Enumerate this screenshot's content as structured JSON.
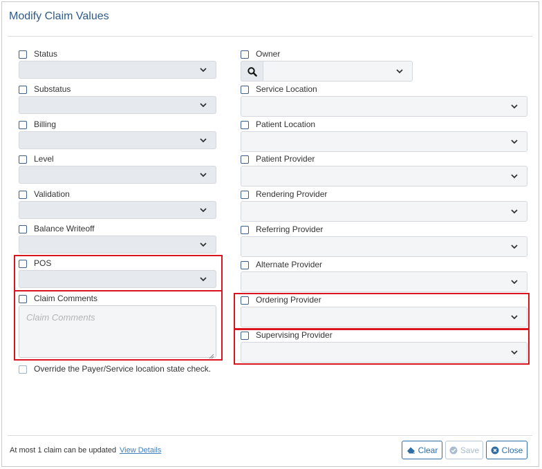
{
  "dialog": {
    "title": "Modify Claim Values"
  },
  "left_fields": [
    {
      "label": "Status"
    },
    {
      "label": "Substatus"
    },
    {
      "label": "Billing"
    },
    {
      "label": "Level"
    },
    {
      "label": "Validation"
    },
    {
      "label": "Balance Writeoff"
    },
    {
      "label": "POS"
    }
  ],
  "claim_comments": {
    "label": "Claim Comments",
    "placeholder": "Claim Comments"
  },
  "override": {
    "label": "Override the Payer/Service location state check."
  },
  "owner": {
    "label": "Owner",
    "search_icon": "search-icon"
  },
  "right_fields": [
    {
      "label": "Service Location"
    },
    {
      "label": "Patient Location"
    },
    {
      "label": "Patient Provider"
    },
    {
      "label": "Rendering Provider"
    },
    {
      "label": "Referring Provider"
    },
    {
      "label": "Alternate Provider"
    },
    {
      "label": "Ordering Provider"
    },
    {
      "label": "Supervising Provider"
    }
  ],
  "footer": {
    "note": "At most 1 claim can be updated",
    "view_details": "View Details",
    "clear_label": "Clear",
    "save_label": "Save",
    "close_label": "Close"
  },
  "colors": {
    "highlight": "#d9141e",
    "title": "#2e5b8a",
    "button": "#2e6da4"
  }
}
